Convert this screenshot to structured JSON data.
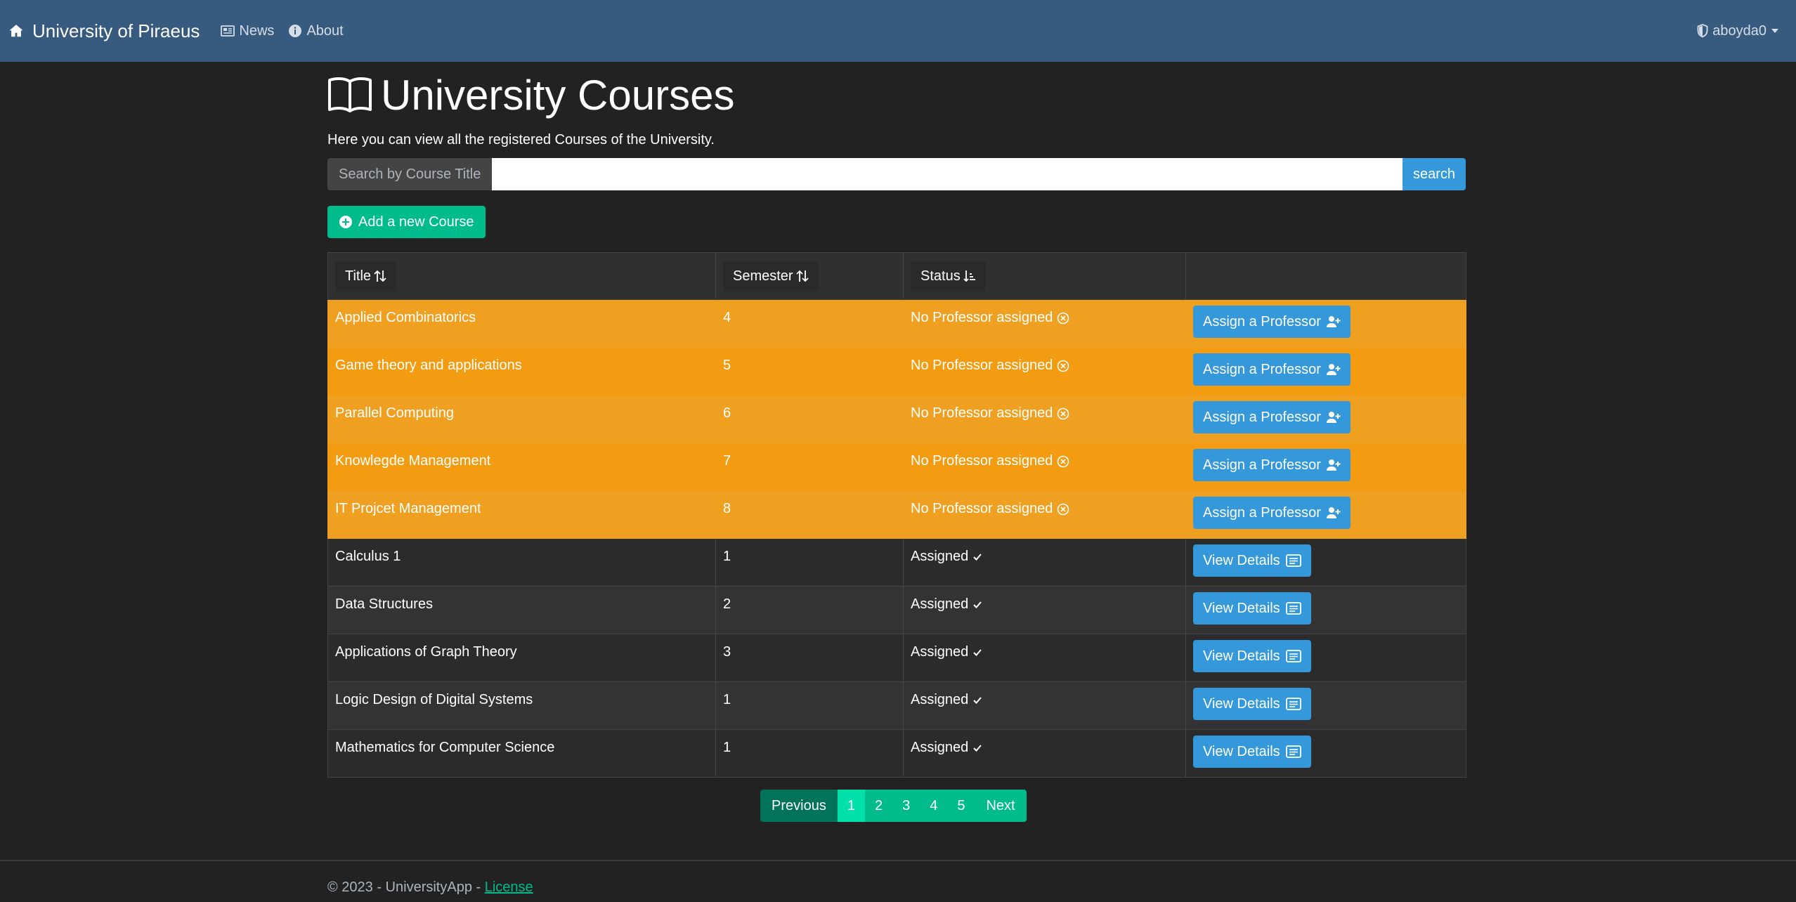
{
  "navbar": {
    "brand": "University of Piraeus",
    "links": [
      {
        "label": "News",
        "icon": "newspaper-icon"
      },
      {
        "label": "About",
        "icon": "info-icon"
      }
    ],
    "user": "aboyda0"
  },
  "page": {
    "title": "University Courses",
    "lead": "Here you can view all the registered Courses of the University."
  },
  "search": {
    "label": "Search by Course Title",
    "value": "",
    "button": "search"
  },
  "add_button": "Add a new Course",
  "table": {
    "headers": [
      "Title",
      "Semester",
      "Status"
    ],
    "rows": [
      {
        "title": "Applied Combinatorics",
        "semester": "4",
        "status": "No Professor assigned",
        "action": "Assign a Professor"
      },
      {
        "title": "Game theory and applications",
        "semester": "5",
        "status": "No Professor assigned",
        "action": "Assign a Professor"
      },
      {
        "title": "Parallel Computing",
        "semester": "6",
        "status": "No Professor assigned",
        "action": "Assign a Professor"
      },
      {
        "title": "Knowlegde Management",
        "semester": "7",
        "status": "No Professor assigned",
        "action": "Assign a Professor"
      },
      {
        "title": "IT Projcet Management",
        "semester": "8",
        "status": "No Professor assigned",
        "action": "Assign a Professor"
      },
      {
        "title": "Calculus 1",
        "semester": "1",
        "status": "Assigned",
        "action": "View Details"
      },
      {
        "title": "Data Structures",
        "semester": "2",
        "status": "Assigned",
        "action": "View Details"
      },
      {
        "title": "Applications of Graph Theory",
        "semester": "3",
        "status": "Assigned",
        "action": "View Details"
      },
      {
        "title": "Logic Design of Digital Systems",
        "semester": "1",
        "status": "Assigned",
        "action": "View Details"
      },
      {
        "title": "Mathematics for Computer Science",
        "semester": "1",
        "status": "Assigned",
        "action": "View Details"
      }
    ]
  },
  "pagination": {
    "previous": "Previous",
    "pages": [
      "1",
      "2",
      "3",
      "4",
      "5"
    ],
    "active": "1",
    "next": "Next"
  },
  "footer": {
    "text": "© 2023 - UniversityApp -",
    "link": "License"
  },
  "colors": {
    "navbar": "#375a7f",
    "background": "#222222",
    "warning_row": "#f39c12",
    "primary": "#3498db",
    "success": "#00bc8c"
  }
}
